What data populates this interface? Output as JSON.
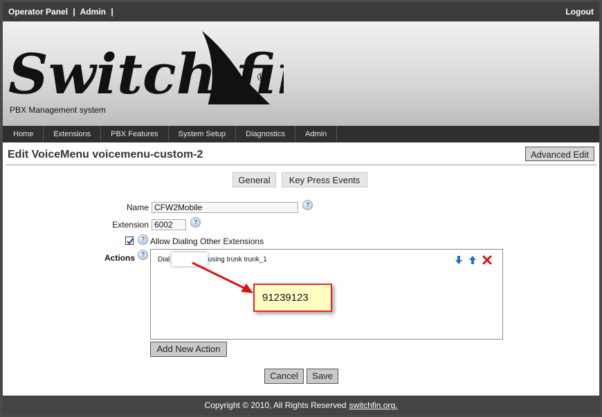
{
  "topbar": {
    "operator_panel": "Operator Panel",
    "admin": "Admin",
    "separator": "|",
    "logout": "Logout"
  },
  "banner": {
    "logo_text": "Switch fin",
    "registered_mark": "®",
    "subtitle": "PBX Management system"
  },
  "nav": {
    "items": [
      {
        "label": "Home"
      },
      {
        "label": "Extensions"
      },
      {
        "label": "PBX Features"
      },
      {
        "label": "System Setup"
      },
      {
        "label": "Diagnostics"
      },
      {
        "label": "Admin"
      }
    ]
  },
  "page": {
    "title": "Edit VoiceMenu voicemenu-custom-2",
    "advanced_edit": "Advanced Edit"
  },
  "tabs": {
    "general": "General",
    "key_press_events": "Key Press Events"
  },
  "form": {
    "name_label": "Name",
    "name_value": "CFW2Mobile",
    "extension_label": "Extension",
    "extension_value": "6002",
    "allow_dialing_label": "Allow Dialing Other Extensions",
    "allow_dialing_checked": true,
    "actions_label": "Actions",
    "help_glyph": "?"
  },
  "actions": {
    "items": [
      {
        "prefix": "Dial",
        "suffix": "using trunk trunk_1"
      }
    ],
    "add_new": "Add New Action"
  },
  "callout": {
    "text": "91239123",
    "border_color": "#e22222",
    "arrow_color": "#dd1111"
  },
  "buttons": {
    "cancel": "Cancel",
    "save": "Save"
  },
  "footer": {
    "copyright": "Copyright © 2010, All Rights Reserved",
    "link": "switchfin.org."
  },
  "icons": {
    "move_down": "arrow-down-icon",
    "move_up": "arrow-up-icon",
    "delete": "delete-icon",
    "help": "help-icon",
    "logo": "fin-logo-icon"
  }
}
